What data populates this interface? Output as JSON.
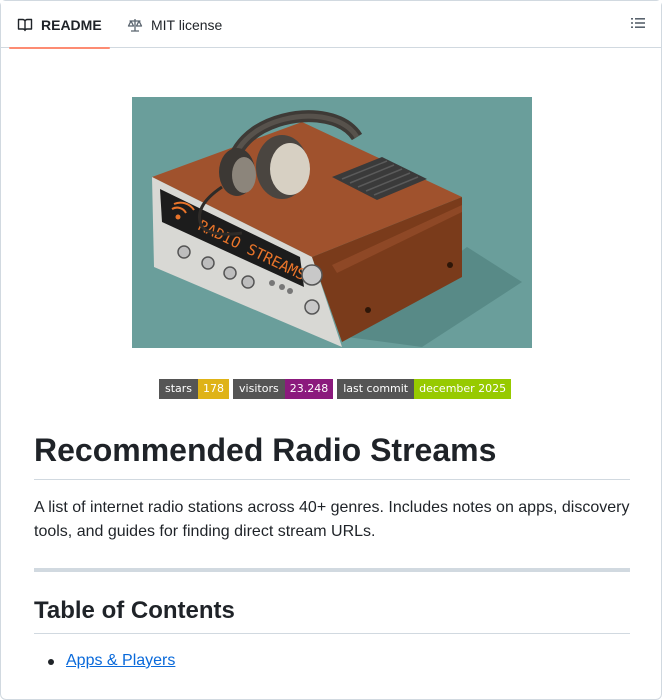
{
  "tabs": {
    "readme_label": "README",
    "license_label": "MIT license"
  },
  "hero": {
    "display_text": "RADIO STREAMS"
  },
  "badges": [
    {
      "key": "stars",
      "value": "178",
      "color": "#dfb317"
    },
    {
      "key": "visitors",
      "value": "23.248",
      "color": "#8b1a7d"
    },
    {
      "key": "last commit",
      "value": "december 2025",
      "color": "#97ca00"
    }
  ],
  "readme": {
    "title": "Recommended Radio Streams",
    "intro": "A list of internet radio stations across 40+ genres. Includes notes on apps, discovery tools, and guides for finding direct stream URLs.",
    "toc_heading": "Table of Contents",
    "toc_items": [
      "Apps & Players"
    ]
  },
  "colors": {
    "accent_underline": "#fd8c73",
    "link": "#0969da",
    "hero_background": "#6a9e9b"
  }
}
